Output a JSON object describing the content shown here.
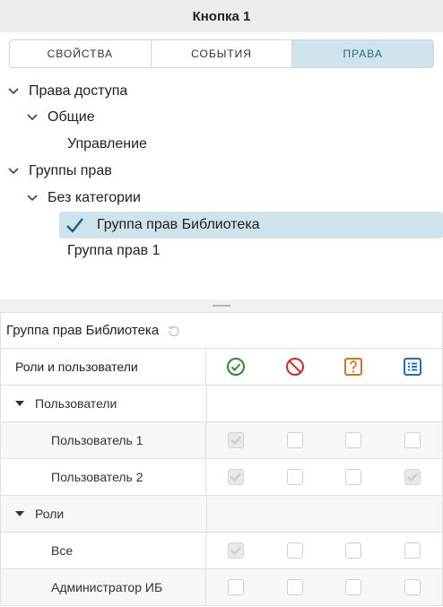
{
  "window": {
    "title": "Кнопка 1"
  },
  "tabs": [
    {
      "label": "СВОЙСТВА",
      "active": false
    },
    {
      "label": "СОБЫТИЯ",
      "active": false
    },
    {
      "label": "ПРАВА",
      "active": true
    }
  ],
  "tree": {
    "access_rights": "Права доступа",
    "general": "Общие",
    "management": "Управление",
    "rights_groups": "Группы прав",
    "no_category": "Без категории",
    "group_library": "Группа прав Библиотека",
    "group_1": "Группа прав 1"
  },
  "panel": {
    "title": "Группа прав Библиотека"
  },
  "grid": {
    "header_label": "Роли и пользователи",
    "columns": [
      {
        "icon": "allow-icon",
        "color": "#2e8b2e"
      },
      {
        "icon": "deny-icon",
        "color": "#d62828"
      },
      {
        "icon": "ask-icon",
        "color": "#e0701a"
      },
      {
        "icon": "list-icon",
        "color": "#1f6fc4"
      }
    ],
    "rows": [
      {
        "type": "group",
        "label": "Пользователи"
      },
      {
        "type": "item",
        "label": "Пользователь 1",
        "checks": [
          true,
          false,
          false,
          false
        ]
      },
      {
        "type": "item",
        "label": "Пользователь 2",
        "checks": [
          true,
          false,
          false,
          true
        ]
      },
      {
        "type": "group",
        "label": "Роли"
      },
      {
        "type": "item",
        "label": "Все",
        "checks": [
          true,
          false,
          false,
          false
        ]
      },
      {
        "type": "item",
        "label": "Администратор ИБ",
        "checks": [
          false,
          false,
          false,
          false
        ]
      }
    ]
  }
}
